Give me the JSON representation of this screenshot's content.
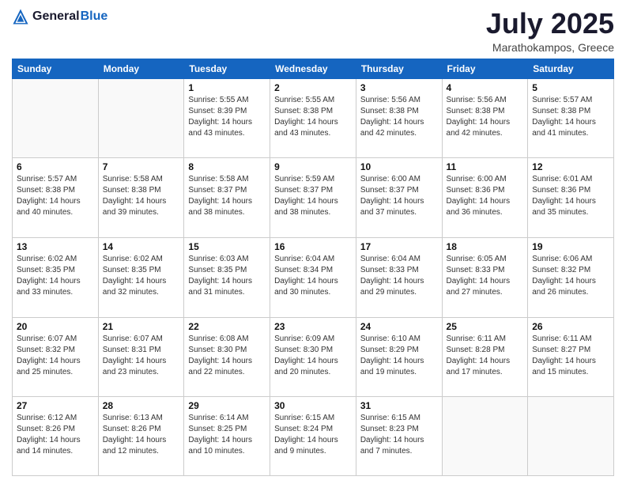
{
  "header": {
    "logo_general": "General",
    "logo_blue": "Blue",
    "title": "July 2025",
    "location": "Marathokampos, Greece"
  },
  "weekdays": [
    "Sunday",
    "Monday",
    "Tuesday",
    "Wednesday",
    "Thursday",
    "Friday",
    "Saturday"
  ],
  "weeks": [
    [
      {
        "day": "",
        "info": ""
      },
      {
        "day": "",
        "info": ""
      },
      {
        "day": "1",
        "info": "Sunrise: 5:55 AM\nSunset: 8:39 PM\nDaylight: 14 hours\nand 43 minutes."
      },
      {
        "day": "2",
        "info": "Sunrise: 5:55 AM\nSunset: 8:38 PM\nDaylight: 14 hours\nand 43 minutes."
      },
      {
        "day": "3",
        "info": "Sunrise: 5:56 AM\nSunset: 8:38 PM\nDaylight: 14 hours\nand 42 minutes."
      },
      {
        "day": "4",
        "info": "Sunrise: 5:56 AM\nSunset: 8:38 PM\nDaylight: 14 hours\nand 42 minutes."
      },
      {
        "day": "5",
        "info": "Sunrise: 5:57 AM\nSunset: 8:38 PM\nDaylight: 14 hours\nand 41 minutes."
      }
    ],
    [
      {
        "day": "6",
        "info": "Sunrise: 5:57 AM\nSunset: 8:38 PM\nDaylight: 14 hours\nand 40 minutes."
      },
      {
        "day": "7",
        "info": "Sunrise: 5:58 AM\nSunset: 8:38 PM\nDaylight: 14 hours\nand 39 minutes."
      },
      {
        "day": "8",
        "info": "Sunrise: 5:58 AM\nSunset: 8:37 PM\nDaylight: 14 hours\nand 38 minutes."
      },
      {
        "day": "9",
        "info": "Sunrise: 5:59 AM\nSunset: 8:37 PM\nDaylight: 14 hours\nand 38 minutes."
      },
      {
        "day": "10",
        "info": "Sunrise: 6:00 AM\nSunset: 8:37 PM\nDaylight: 14 hours\nand 37 minutes."
      },
      {
        "day": "11",
        "info": "Sunrise: 6:00 AM\nSunset: 8:36 PM\nDaylight: 14 hours\nand 36 minutes."
      },
      {
        "day": "12",
        "info": "Sunrise: 6:01 AM\nSunset: 8:36 PM\nDaylight: 14 hours\nand 35 minutes."
      }
    ],
    [
      {
        "day": "13",
        "info": "Sunrise: 6:02 AM\nSunset: 8:35 PM\nDaylight: 14 hours\nand 33 minutes."
      },
      {
        "day": "14",
        "info": "Sunrise: 6:02 AM\nSunset: 8:35 PM\nDaylight: 14 hours\nand 32 minutes."
      },
      {
        "day": "15",
        "info": "Sunrise: 6:03 AM\nSunset: 8:35 PM\nDaylight: 14 hours\nand 31 minutes."
      },
      {
        "day": "16",
        "info": "Sunrise: 6:04 AM\nSunset: 8:34 PM\nDaylight: 14 hours\nand 30 minutes."
      },
      {
        "day": "17",
        "info": "Sunrise: 6:04 AM\nSunset: 8:33 PM\nDaylight: 14 hours\nand 29 minutes."
      },
      {
        "day": "18",
        "info": "Sunrise: 6:05 AM\nSunset: 8:33 PM\nDaylight: 14 hours\nand 27 minutes."
      },
      {
        "day": "19",
        "info": "Sunrise: 6:06 AM\nSunset: 8:32 PM\nDaylight: 14 hours\nand 26 minutes."
      }
    ],
    [
      {
        "day": "20",
        "info": "Sunrise: 6:07 AM\nSunset: 8:32 PM\nDaylight: 14 hours\nand 25 minutes."
      },
      {
        "day": "21",
        "info": "Sunrise: 6:07 AM\nSunset: 8:31 PM\nDaylight: 14 hours\nand 23 minutes."
      },
      {
        "day": "22",
        "info": "Sunrise: 6:08 AM\nSunset: 8:30 PM\nDaylight: 14 hours\nand 22 minutes."
      },
      {
        "day": "23",
        "info": "Sunrise: 6:09 AM\nSunset: 8:30 PM\nDaylight: 14 hours\nand 20 minutes."
      },
      {
        "day": "24",
        "info": "Sunrise: 6:10 AM\nSunset: 8:29 PM\nDaylight: 14 hours\nand 19 minutes."
      },
      {
        "day": "25",
        "info": "Sunrise: 6:11 AM\nSunset: 8:28 PM\nDaylight: 14 hours\nand 17 minutes."
      },
      {
        "day": "26",
        "info": "Sunrise: 6:11 AM\nSunset: 8:27 PM\nDaylight: 14 hours\nand 15 minutes."
      }
    ],
    [
      {
        "day": "27",
        "info": "Sunrise: 6:12 AM\nSunset: 8:26 PM\nDaylight: 14 hours\nand 14 minutes."
      },
      {
        "day": "28",
        "info": "Sunrise: 6:13 AM\nSunset: 8:26 PM\nDaylight: 14 hours\nand 12 minutes."
      },
      {
        "day": "29",
        "info": "Sunrise: 6:14 AM\nSunset: 8:25 PM\nDaylight: 14 hours\nand 10 minutes."
      },
      {
        "day": "30",
        "info": "Sunrise: 6:15 AM\nSunset: 8:24 PM\nDaylight: 14 hours\nand 9 minutes."
      },
      {
        "day": "31",
        "info": "Sunrise: 6:15 AM\nSunset: 8:23 PM\nDaylight: 14 hours\nand 7 minutes."
      },
      {
        "day": "",
        "info": ""
      },
      {
        "day": "",
        "info": ""
      }
    ]
  ]
}
